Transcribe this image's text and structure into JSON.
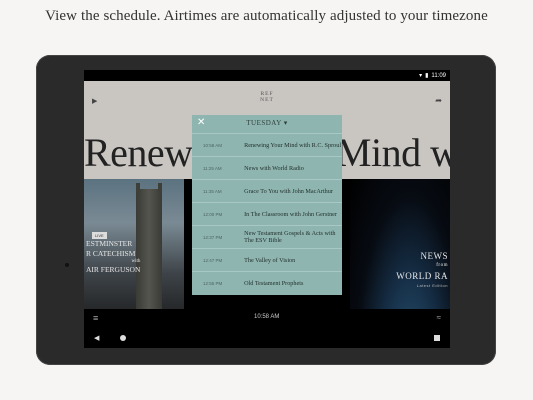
{
  "caption": "View the schedule. Airtimes are automatically adjusted to your timezone",
  "status": {
    "time": "11:09"
  },
  "header": {
    "logo_line1": "REF",
    "logo_line2": "NET",
    "play_icon": "play-icon",
    "share_icon": "share-icon"
  },
  "hero_title": "Renewing Your Mind with R",
  "left_card": {
    "badge": "LIVE",
    "line1": "ESTMINSTER",
    "line2": "R CATECHISM",
    "line3": "AIR FERGUSON",
    "small": "with"
  },
  "right_card": {
    "line1": "NEWS",
    "from": "from",
    "line2": "WORLD RA",
    "sub": "Latest Edition"
  },
  "bottom": {
    "time": "10:58 AM",
    "menu_icon": "menu-icon",
    "waves_icon": "waves-icon"
  },
  "nav": {
    "back_icon": "back-icon",
    "home_icon": "home-icon",
    "recent_icon": "recent-icon"
  },
  "schedule": {
    "day": "TUESDAY ▾",
    "rows": [
      {
        "time": "10:58 AM",
        "title": "Renewing Your Mind with R.C. Sproul"
      },
      {
        "time": "11:25 AM",
        "title": "News with World Radio"
      },
      {
        "time": "11:35 AM",
        "title": "Grace To You with John MacArthur"
      },
      {
        "time": "12:00 PM",
        "title": "In The Classroom with John Gerstner"
      },
      {
        "time": "12:37 PM",
        "title": "New Testament Gospels & Acts with The ESV Bible"
      },
      {
        "time": "12:47 PM",
        "title": "The Valley of Vision"
      },
      {
        "time": "12:55 PM",
        "title": "Old Testament Prophets"
      }
    ]
  },
  "colors": {
    "panel": "#8fb5b0",
    "header": "#c9c6c2"
  }
}
